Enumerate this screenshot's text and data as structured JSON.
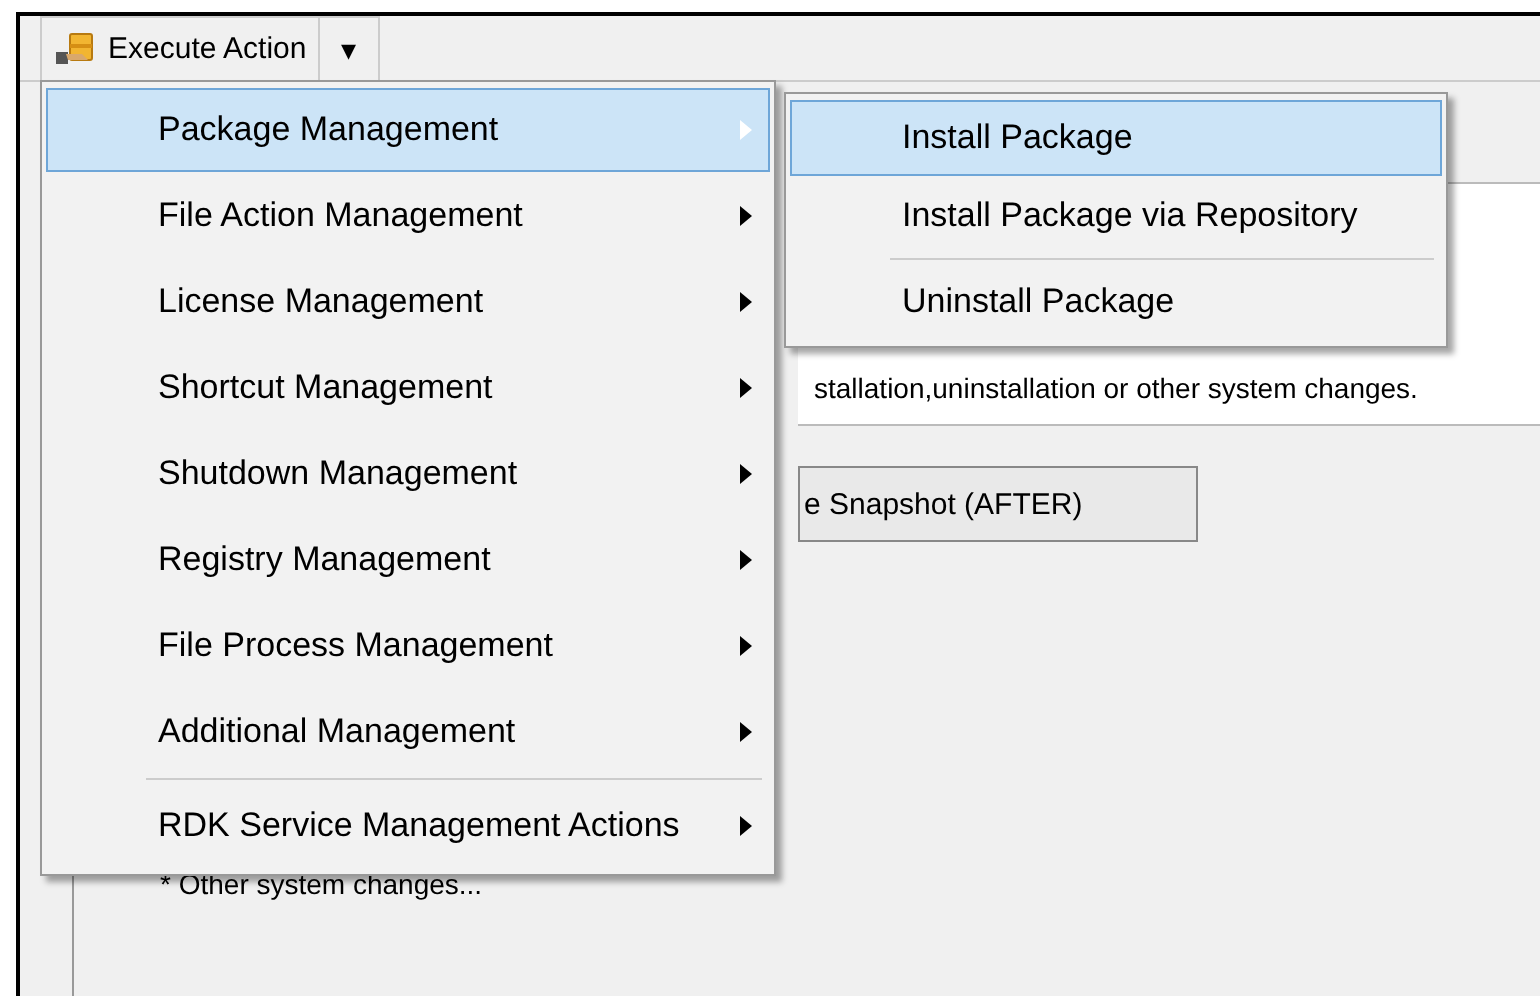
{
  "toolbar": {
    "execute_button": {
      "label": "Execute Action"
    },
    "dropdown_arrow": "▾"
  },
  "menu": {
    "items": [
      {
        "label": "Package Management",
        "selected": true,
        "separator_before": false
      },
      {
        "label": "File Action Management",
        "selected": false,
        "separator_before": false
      },
      {
        "label": "License Management",
        "selected": false,
        "separator_before": false
      },
      {
        "label": "Shortcut Management",
        "selected": false,
        "separator_before": false
      },
      {
        "label": "Shutdown Management",
        "selected": false,
        "separator_before": false
      },
      {
        "label": "Registry Management",
        "selected": false,
        "separator_before": false
      },
      {
        "label": "File Process Management",
        "selected": false,
        "separator_before": false
      },
      {
        "label": "Additional Management",
        "selected": false,
        "separator_before": false
      },
      {
        "label": "RDK Service Management Actions",
        "selected": false,
        "separator_before": true
      }
    ]
  },
  "submenu": {
    "items": [
      {
        "label": "Install Package",
        "selected": true,
        "separator_before": false
      },
      {
        "label": "Install Package via Repository",
        "selected": false,
        "separator_before": false
      },
      {
        "label": "Uninstall Package",
        "selected": false,
        "separator_before": true
      }
    ]
  },
  "panel": {
    "description": "stallation,uninstallation or other system changes.",
    "snapshot_button": "e Snapshot (AFTER)",
    "note": "* Other system changes..."
  }
}
